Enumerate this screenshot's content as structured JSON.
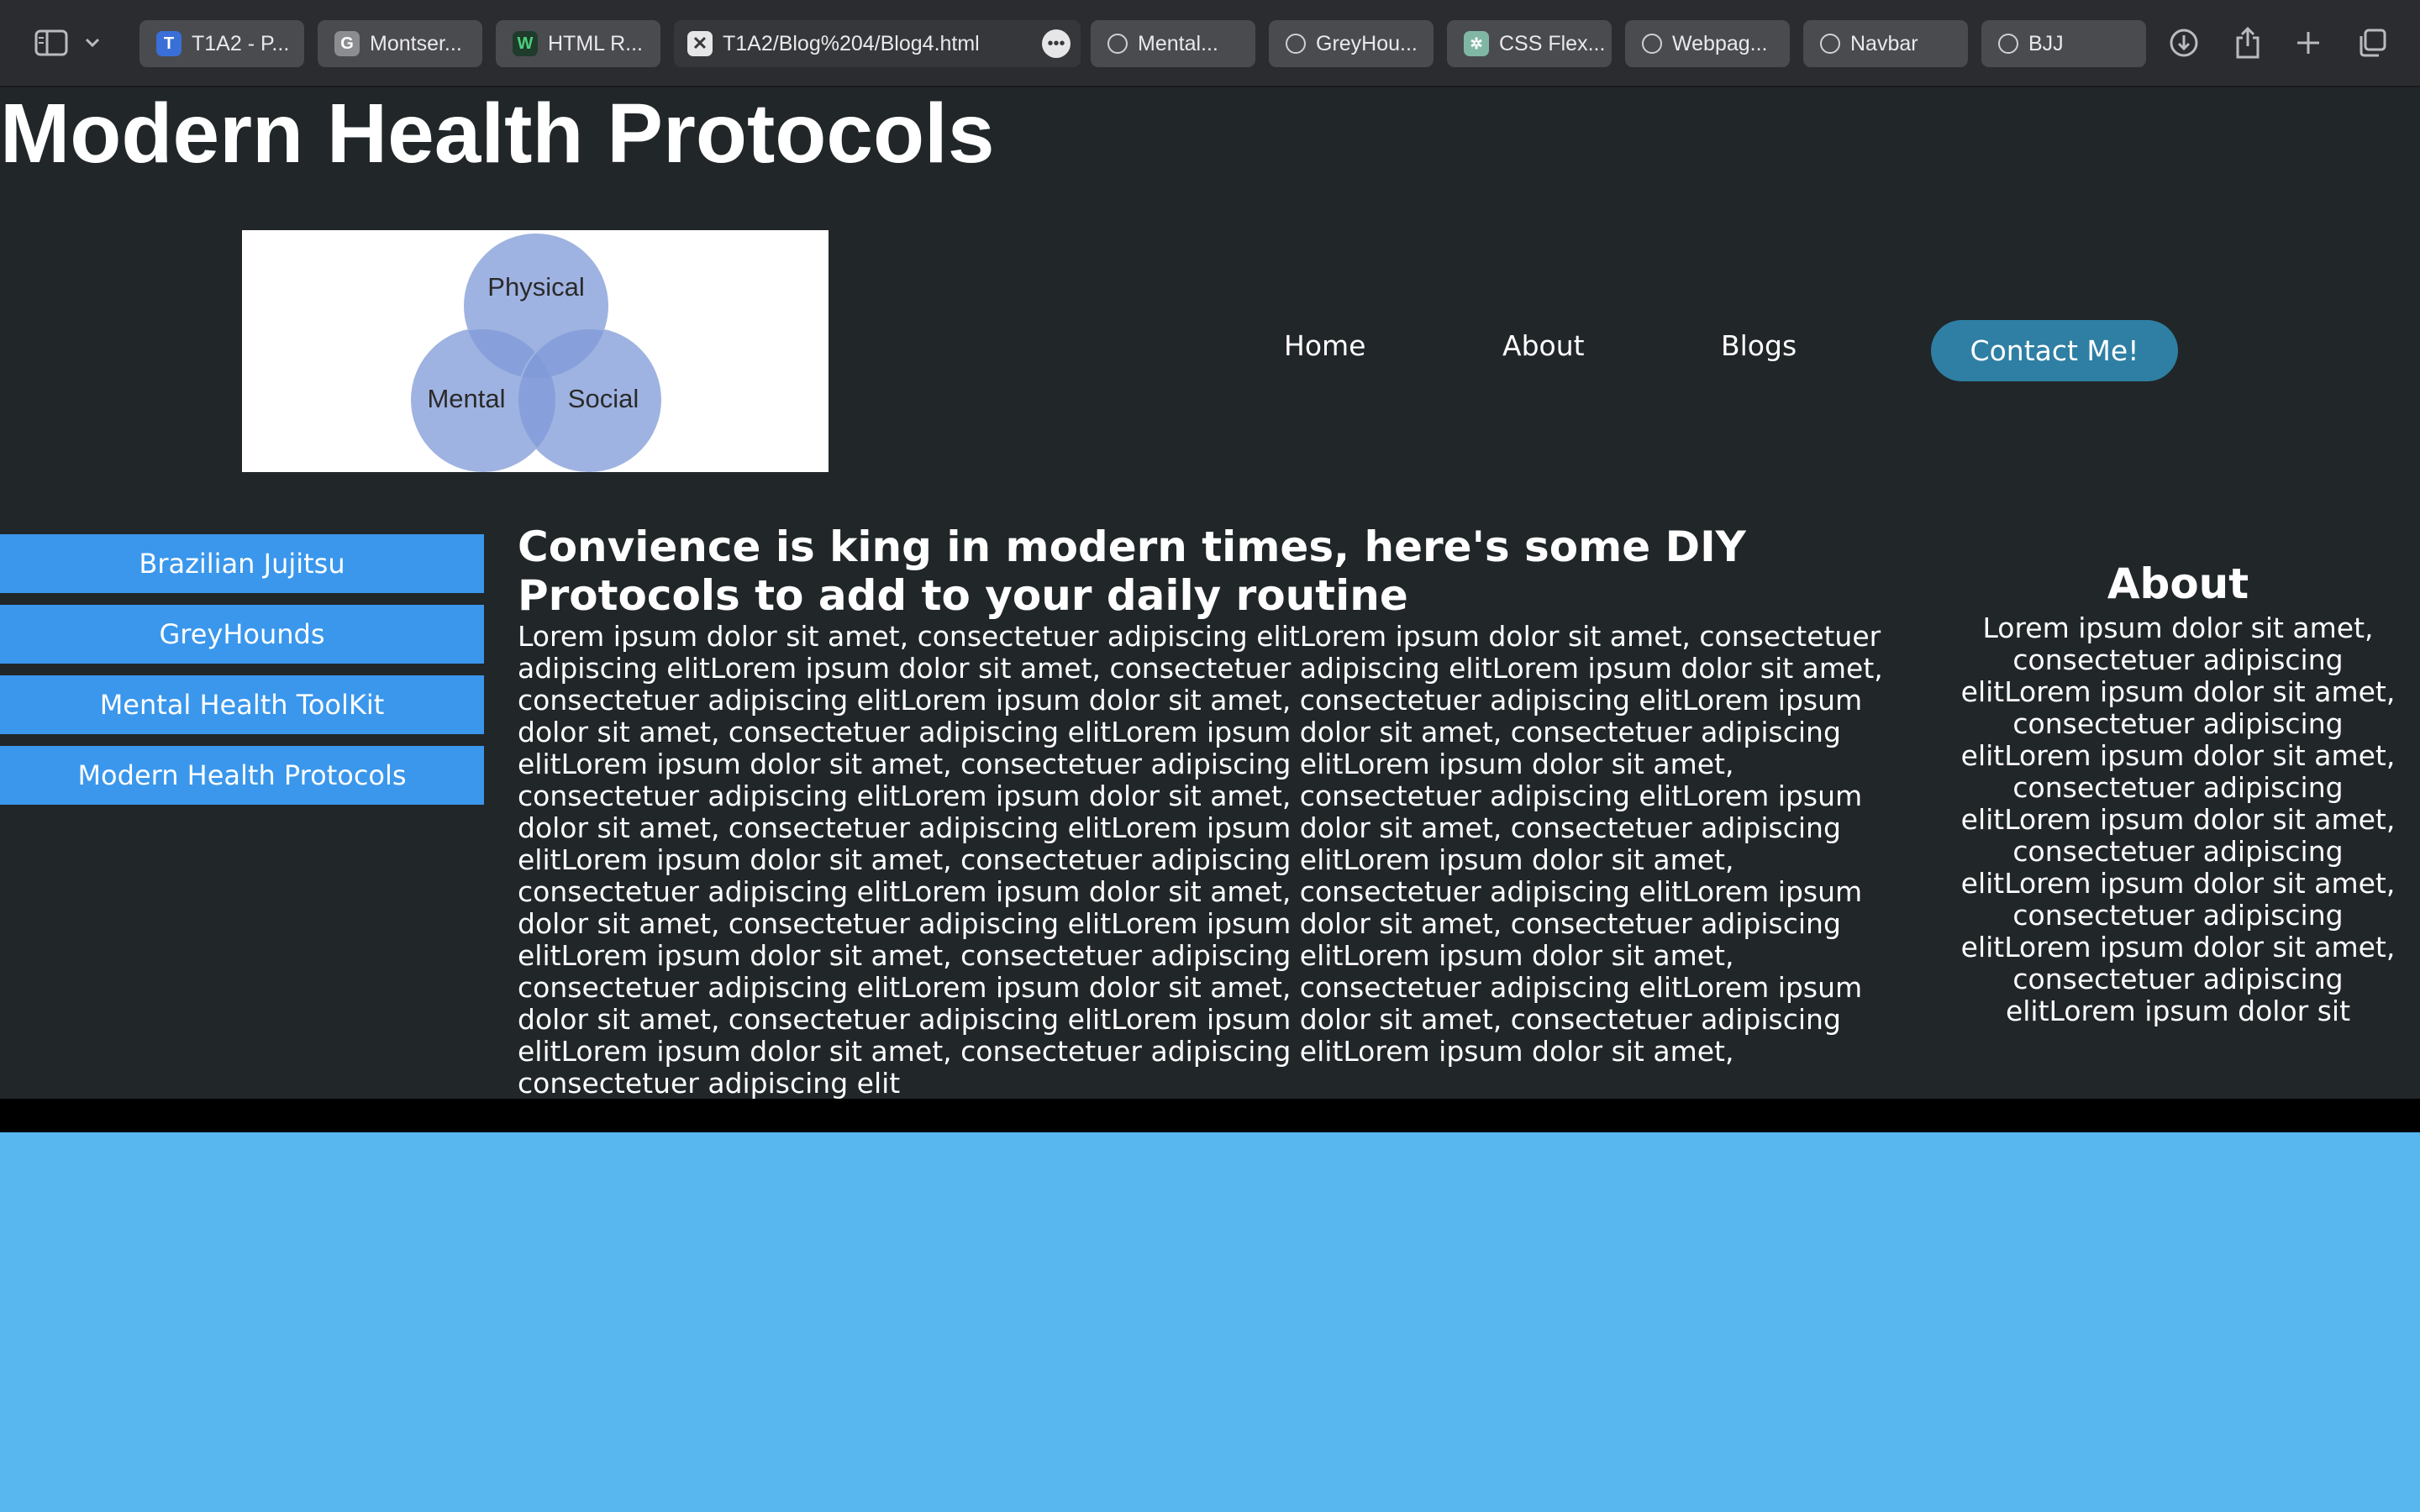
{
  "browser": {
    "tabs": [
      {
        "label": "T1A2 - P...",
        "favicon": "T1A2-favicon",
        "active": false
      },
      {
        "label": "Montser...",
        "favicon": "G",
        "active": false
      },
      {
        "label": "HTML R...",
        "favicon": "W",
        "active": false
      },
      {
        "label": "T1A2/Blog%204/Blog4.html",
        "favicon": "close-icon",
        "active": true
      },
      {
        "label": "Mental...",
        "favicon": "compass-icon",
        "active": false
      },
      {
        "label": "GreyHou...",
        "favicon": "compass-icon",
        "active": false
      },
      {
        "label": "CSS Flex...",
        "favicon": "openai-icon",
        "active": false
      },
      {
        "label": "Webpag...",
        "favicon": "compass-icon",
        "active": false
      },
      {
        "label": "Navbar",
        "favicon": "compass-icon",
        "active": false
      },
      {
        "label": "BJJ",
        "favicon": "compass-icon",
        "active": false
      }
    ],
    "toolbar_icons": [
      "sidebar-icon",
      "chevron-down-icon",
      "more-icon",
      "download-icon",
      "share-icon",
      "plus-icon",
      "tabs-overview-icon"
    ]
  },
  "site": {
    "title": "Modern Health Protocols",
    "venn": {
      "top": "Physical",
      "left": "Mental",
      "right": "Social",
      "color": "#7f9ad8"
    },
    "nav": {
      "home": "Home",
      "about": "About",
      "blogs": "Blogs",
      "contact": "Contact Me!"
    },
    "sidebar": [
      {
        "label": "Brazilian Jujitsu"
      },
      {
        "label": "GreyHounds"
      },
      {
        "label": "Mental Health ToolKit"
      },
      {
        "label": "Modern Health Protocols"
      }
    ],
    "post": {
      "title": "Convience is king in modern times, here's some DIY Protocols to add to your daily routine",
      "body": "Lorem ipsum dolor sit amet, consectetuer adipiscing elitLorem ipsum dolor sit amet, consectetuer adipiscing elitLorem ipsum dolor sit amet, consectetuer adipiscing elitLorem ipsum dolor sit amet, consectetuer adipiscing elitLorem ipsum dolor sit amet, consectetuer adipiscing elitLorem ipsum dolor sit amet, consectetuer adipiscing elitLorem ipsum dolor sit amet, consectetuer adipiscing elitLorem ipsum dolor sit amet, consectetuer adipiscing elitLorem ipsum dolor sit amet, consectetuer adipiscing elitLorem ipsum dolor sit amet, consectetuer adipiscing elitLorem ipsum dolor sit amet, consectetuer adipiscing elitLorem ipsum dolor sit amet, consectetuer adipiscing elitLorem ipsum dolor sit amet, consectetuer adipiscing elitLorem ipsum dolor sit amet, consectetuer adipiscing elitLorem ipsum dolor sit amet, consectetuer adipiscing elitLorem ipsum dolor sit amet, consectetuer adipiscing elitLorem ipsum dolor sit amet, consectetuer adipiscing elitLorem ipsum dolor sit amet, consectetuer adipiscing elitLorem ipsum dolor sit amet, consectetuer adipiscing elitLorem ipsum dolor sit amet, consectetuer adipiscing elitLorem ipsum dolor sit amet, consectetuer adipiscing elitLorem ipsum dolor sit amet, consectetuer adipiscing elitLorem ipsum dolor sit amet, consectetuer adipiscing elitLorem ipsum dolor sit amet, consectetuer adipiscing elit"
    },
    "about": {
      "title": "About",
      "body": "Lorem ipsum dolor sit amet, consectetuer adipiscing elitLorem ipsum dolor sit amet, consectetuer adipiscing elitLorem ipsum dolor sit amet, consectetuer adipiscing elitLorem ipsum dolor sit amet, consectetuer adipiscing elitLorem ipsum dolor sit amet, consectetuer adipiscing elitLorem ipsum dolor sit amet, consectetuer adipiscing elitLorem ipsum dolor sit"
    }
  },
  "colors": {
    "page_bg": "#212629",
    "button_blue": "#3a97ec",
    "contact_bg": "#2e7fa3",
    "footer": "#000000",
    "below_page": "#58b7ef"
  }
}
